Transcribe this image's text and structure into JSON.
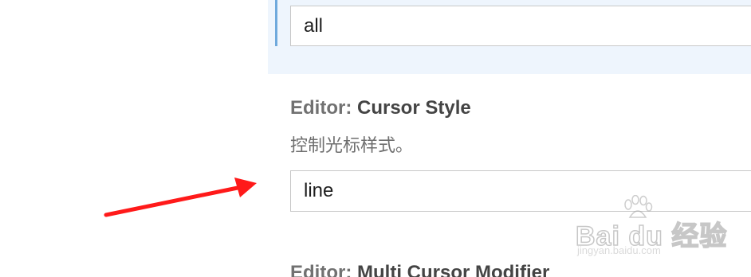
{
  "settings": [
    {
      "value": "all"
    },
    {
      "title_prefix": "Editor: ",
      "title_name": "Cursor Style",
      "description": "控制光标样式。",
      "value": "line"
    },
    {
      "title_prefix": "Editor: ",
      "title_name": "Multi Cursor Modifier"
    }
  ],
  "annotation": {
    "arrow_color": "#ff1a1a",
    "arrow_target": "cursor-style-input"
  },
  "watermark": {
    "logo_text": "Bai du 经验",
    "url_text": "jingyan.baidu.com"
  },
  "colors": {
    "focus_bar": "#6fa9dc",
    "focused_row_bg": "#eef5fd",
    "input_border": "#c8c8c8"
  }
}
